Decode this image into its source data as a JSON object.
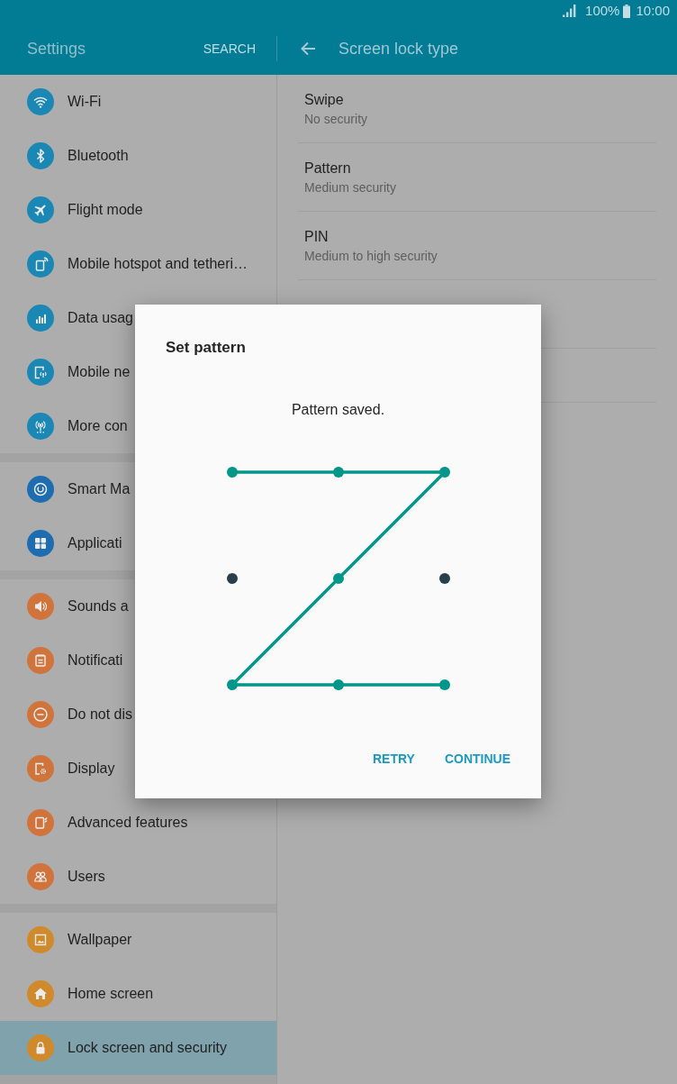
{
  "status_bar": {
    "battery": "100%",
    "time": "10:00"
  },
  "header": {
    "title": "Settings",
    "search_button": "SEARCH",
    "page_title": "Screen lock type"
  },
  "sidebar": {
    "groups": [
      {
        "items": [
          {
            "label": "Wi-Fi",
            "color": "#1b87b4",
            "selected": false
          },
          {
            "label": "Bluetooth",
            "color": "#1b87b4",
            "selected": false
          },
          {
            "label": "Flight mode",
            "color": "#1b87b4",
            "selected": false
          },
          {
            "label": "Mobile hotspot and tetheri…",
            "color": "#1b87b4",
            "selected": false
          },
          {
            "label": "Data usag",
            "color": "#1b87b4",
            "selected": false
          },
          {
            "label": "Mobile ne",
            "color": "#1b87b4",
            "selected": false
          },
          {
            "label": "More con",
            "color": "#1b87b4",
            "selected": false
          }
        ]
      },
      {
        "items": [
          {
            "label": "Smart Ma",
            "color": "#1d6db0",
            "selected": false
          },
          {
            "label": "Applicati",
            "color": "#1d6db0",
            "selected": false
          }
        ]
      },
      {
        "items": [
          {
            "label": "Sounds a",
            "color": "#d0743c",
            "selected": false
          },
          {
            "label": "Notificati",
            "color": "#d0743c",
            "selected": false
          },
          {
            "label": "Do not dis",
            "color": "#d0743c",
            "selected": false
          },
          {
            "label": "Display",
            "color": "#d0743c",
            "selected": false
          },
          {
            "label": "Advanced features",
            "color": "#d0743c",
            "selected": false
          },
          {
            "label": "Users",
            "color": "#d0743c",
            "selected": false
          }
        ]
      },
      {
        "items": [
          {
            "label": "Wallpaper",
            "color": "#d08a2b",
            "selected": false
          },
          {
            "label": "Home screen",
            "color": "#d08a2b",
            "selected": false
          },
          {
            "label": "Lock screen and security",
            "color": "#d08a2b",
            "selected": true
          }
        ]
      }
    ]
  },
  "lock_types": [
    {
      "title": "Swipe",
      "subtitle": "No security"
    },
    {
      "title": "Pattern",
      "subtitle": "Medium security"
    },
    {
      "title": "PIN",
      "subtitle": "Medium to high security"
    }
  ],
  "dialog": {
    "title": "Set pattern",
    "message": "Pattern saved.",
    "pattern": {
      "dots": [
        {
          "selected": true
        },
        {
          "selected": true
        },
        {
          "selected": true
        },
        {
          "selected": false
        },
        {
          "selected": true
        },
        {
          "selected": false
        },
        {
          "selected": true
        },
        {
          "selected": true
        },
        {
          "selected": true
        }
      ]
    },
    "buttons": [
      "RETRY",
      "CONTINUE"
    ]
  }
}
